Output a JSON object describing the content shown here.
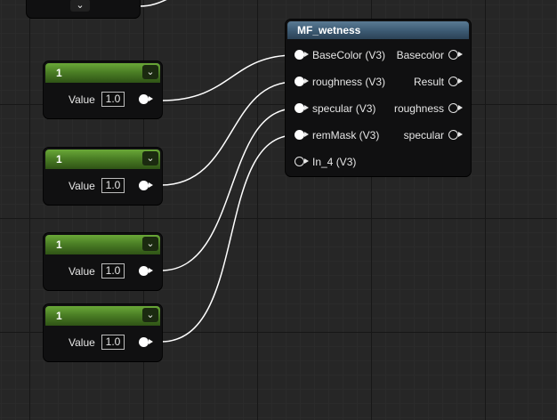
{
  "graph": {
    "material_function": {
      "title": "MF_wetness",
      "inputs": [
        {
          "label": "BaseColor (V3)",
          "connected": true
        },
        {
          "label": "roughness (V3)",
          "connected": true
        },
        {
          "label": "specular (V3)",
          "connected": true
        },
        {
          "label": "remMask (V3)",
          "connected": true
        },
        {
          "label": "In_4 (V3)",
          "connected": false
        }
      ],
      "outputs": [
        {
          "label": "Basecolor"
        },
        {
          "label": "Result"
        },
        {
          "label": "roughness"
        },
        {
          "label": "specular"
        }
      ]
    },
    "constants": [
      {
        "title": "1",
        "value_label": "Value",
        "value": "1.0"
      },
      {
        "title": "1",
        "value_label": "Value",
        "value": "1.0"
      },
      {
        "title": "1",
        "value_label": "Value",
        "value": "1.0"
      },
      {
        "title": "1",
        "value_label": "Value",
        "value": "1.0"
      }
    ],
    "colors": {
      "background": "#262626",
      "constant_header": "#4b7f25",
      "function_header": "#3e5c75",
      "wire": "#ffffff"
    },
    "icons": {
      "collapse": "chevron-down-icon",
      "pin": "exec-pin-icon"
    }
  }
}
